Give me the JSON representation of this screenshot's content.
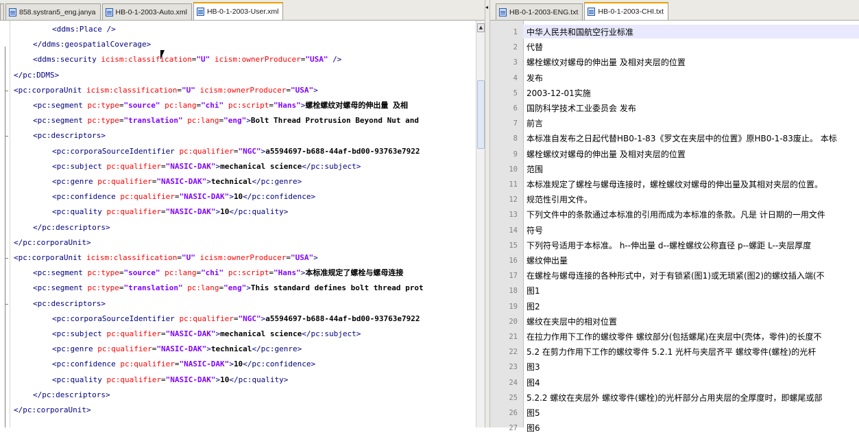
{
  "left_tabs": [
    {
      "label": "",
      "active": false
    },
    {
      "label": "858.systran5_eng.janya",
      "active": false
    },
    {
      "label": "HB-0-1-2003-Auto.xml",
      "active": false
    },
    {
      "label": "HB-0-1-2003-User.xml",
      "active": true
    }
  ],
  "right_tabs": [
    {
      "label": "HB-0-1-2003-ENG.txt",
      "active": false
    },
    {
      "label": "HB-0-1-2003-CHI.txt",
      "active": true
    }
  ],
  "xml_lines": [
    {
      "indent": 3,
      "t": "<ddms:Place />"
    },
    {
      "indent": 2,
      "t": "</ddms:geospatialCoverage>"
    },
    {
      "indent": 2,
      "tag": "<ddms:security",
      "a1": "icism:classification",
      "v1": "\"U\"",
      "a2": "icism:ownerProducer",
      "v2": "\"USA\"",
      "end": " />"
    },
    {
      "indent": 1,
      "t": "</pc:DDMS>"
    },
    {
      "indent": 1,
      "tag": "<pc:corporaUnit",
      "a1": "icism:classification",
      "v1": "\"U\"",
      "a2": "icism:ownerProducer",
      "v2": "\"USA\"",
      "end": ">"
    },
    {
      "indent": 2,
      "tag": "<pc:segment",
      "a1": "pc:type",
      "v1": "\"source\"",
      "a2": "pc:lang",
      "v2": "\"chi\"",
      "a3": "pc:script",
      "v3": "\"Hans\"",
      "end": ">",
      "text": "螺栓螺纹对螺母的伸出量 及相"
    },
    {
      "indent": 2,
      "tag": "<pc:segment",
      "a1": "pc:type",
      "v1": "\"translation\"",
      "a2": "pc:lang",
      "v2": "\"eng\"",
      "end": ">",
      "text": "Bolt Thread Protrusion Beyond Nut and"
    },
    {
      "indent": 2,
      "t": "<pc:descriptors>"
    },
    {
      "indent": 3,
      "tag": "<pc:corporaSourceIdentifier",
      "a1": "pc:qualifier",
      "v1": "\"NGC\"",
      "end": ">",
      "text": "a5594697-b688-44af-bd00-93763e7922"
    },
    {
      "indent": 3,
      "tag": "<pc:subject",
      "a1": "pc:qualifier",
      "v1": "\"NASIC-DAK\"",
      "end": ">",
      "text": "mechanical science",
      "close": "</pc:subject>"
    },
    {
      "indent": 3,
      "tag": "<pc:genre",
      "a1": "pc:qualifier",
      "v1": "\"NASIC-DAK\"",
      "end": ">",
      "text": "technical",
      "close": "</pc:genre>"
    },
    {
      "indent": 3,
      "tag": "<pc:confidence",
      "a1": "pc:qualifier",
      "v1": "\"NASIC-DAK\"",
      "end": ">",
      "text": "10",
      "close": "</pc:confidence>"
    },
    {
      "indent": 3,
      "tag": "<pc:quality",
      "a1": "pc:qualifier",
      "v1": "\"NASIC-DAK\"",
      "end": ">",
      "text": "10",
      "close": "</pc:quality>"
    },
    {
      "indent": 2,
      "t": "</pc:descriptors>"
    },
    {
      "indent": 1,
      "t": "</pc:corporaUnit>"
    },
    {
      "indent": 1,
      "tag": "<pc:corporaUnit",
      "a1": "icism:classification",
      "v1": "\"U\"",
      "a2": "icism:ownerProducer",
      "v2": "\"USA\"",
      "end": ">"
    },
    {
      "indent": 2,
      "tag": "<pc:segment",
      "a1": "pc:type",
      "v1": "\"source\"",
      "a2": "pc:lang",
      "v2": "\"chi\"",
      "a3": "pc:script",
      "v3": "\"Hans\"",
      "end": ">",
      "text": "本标准规定了螺栓与螺母连接"
    },
    {
      "indent": 2,
      "tag": "<pc:segment",
      "a1": "pc:type",
      "v1": "\"translation\"",
      "a2": "pc:lang",
      "v2": "\"eng\"",
      "end": ">",
      "text": "This standard defines bolt thread prot"
    },
    {
      "indent": 2,
      "t": "<pc:descriptors>"
    },
    {
      "indent": 3,
      "tag": "<pc:corporaSourceIdentifier",
      "a1": "pc:qualifier",
      "v1": "\"NGC\"",
      "end": ">",
      "text": "a5594697-b688-44af-bd00-93763e7922"
    },
    {
      "indent": 3,
      "tag": "<pc:subject",
      "a1": "pc:qualifier",
      "v1": "\"NASIC-DAK\"",
      "end": ">",
      "text": "mechanical science",
      "close": "</pc:subject>"
    },
    {
      "indent": 3,
      "tag": "<pc:genre",
      "a1": "pc:qualifier",
      "v1": "\"NASIC-DAK\"",
      "end": ">",
      "text": "technical",
      "close": "</pc:genre>"
    },
    {
      "indent": 3,
      "tag": "<pc:confidence",
      "a1": "pc:qualifier",
      "v1": "\"NASIC-DAK\"",
      "end": ">",
      "text": "10",
      "close": "</pc:confidence>"
    },
    {
      "indent": 3,
      "tag": "<pc:quality",
      "a1": "pc:qualifier",
      "v1": "\"NASIC-DAK\"",
      "end": ">",
      "text": "10",
      "close": "</pc:quality>"
    },
    {
      "indent": 2,
      "t": "</pc:descriptors>"
    },
    {
      "indent": 1,
      "t": "</pc:corporaUnit>"
    }
  ],
  "chi_lines": [
    {
      "n": "1",
      "t": "中华人民共和国航空行业标准"
    },
    {
      "n": "2",
      "t": "代替"
    },
    {
      "n": "3",
      "t": "螺栓螺纹对螺母的伸出量 及相对夹层的位置"
    },
    {
      "n": "4",
      "t": "发布"
    },
    {
      "n": "5",
      "t": "2003-12-01实施"
    },
    {
      "n": "6",
      "t": "国防科学技术工业委员会 发布"
    },
    {
      "n": "7",
      "t": "前言"
    },
    {
      "n": "8",
      "t": "本标准自发布之日起代替HB0-1-83《罗文在夹层中的位置》原HB0-1-83废止。 本标"
    },
    {
      "n": "9",
      "t": "螺栓螺纹对螺母的伸出量 及相对夹层的位置"
    },
    {
      "n": "10",
      "t": "范围"
    },
    {
      "n": "11",
      "t": "本标准规定了螺栓与螺母连接时，螺栓螺纹对螺母的伸出量及其相对夹层的位置。"
    },
    {
      "n": "12",
      "t": "规范性引用文件。"
    },
    {
      "n": "13",
      "t": "下列文件中的条款通过本标准的引用而成为本标准的条款。凡是 计日期的一用文件"
    },
    {
      "n": "14",
      "t": "符号"
    },
    {
      "n": "15",
      "t": "下列符号适用于本标准。 h--伸出量 d--螺栓螺纹公称直径 p--螺距 L--夹层厚度"
    },
    {
      "n": "16",
      "t": "螺纹伸出量"
    },
    {
      "n": "17",
      "t": "在螺栓与螺母连接的各种形式中，对于有锁紧(图1)或无琐紧(图2)的螺纹插入端(不"
    },
    {
      "n": "18",
      "t": "图1"
    },
    {
      "n": "19",
      "t": "图2"
    },
    {
      "n": "20",
      "t": "螺纹在夹层中的相对位置"
    },
    {
      "n": "21",
      "t": "在拉力作用下工作的螺纹零件 螺纹部分(包括螺尾)在夹层中(壳体，零件)的长度不"
    },
    {
      "n": "22",
      "t": "5.2 在剪力作用下工作的螺纹零件 5.2.1 光杆与夹层齐平 螺纹零件(螺栓)的光杆"
    },
    {
      "n": "23",
      "t": "图3"
    },
    {
      "n": "24",
      "t": "图4"
    },
    {
      "n": "25",
      "t": "5.2.2 螺纹在夹层外 螺纹零件(螺栓)的光杆部分占用夹层的全厚度时，即螺尾或部"
    },
    {
      "n": "26",
      "t": "图5"
    },
    {
      "n": "27",
      "t": "图6"
    }
  ]
}
